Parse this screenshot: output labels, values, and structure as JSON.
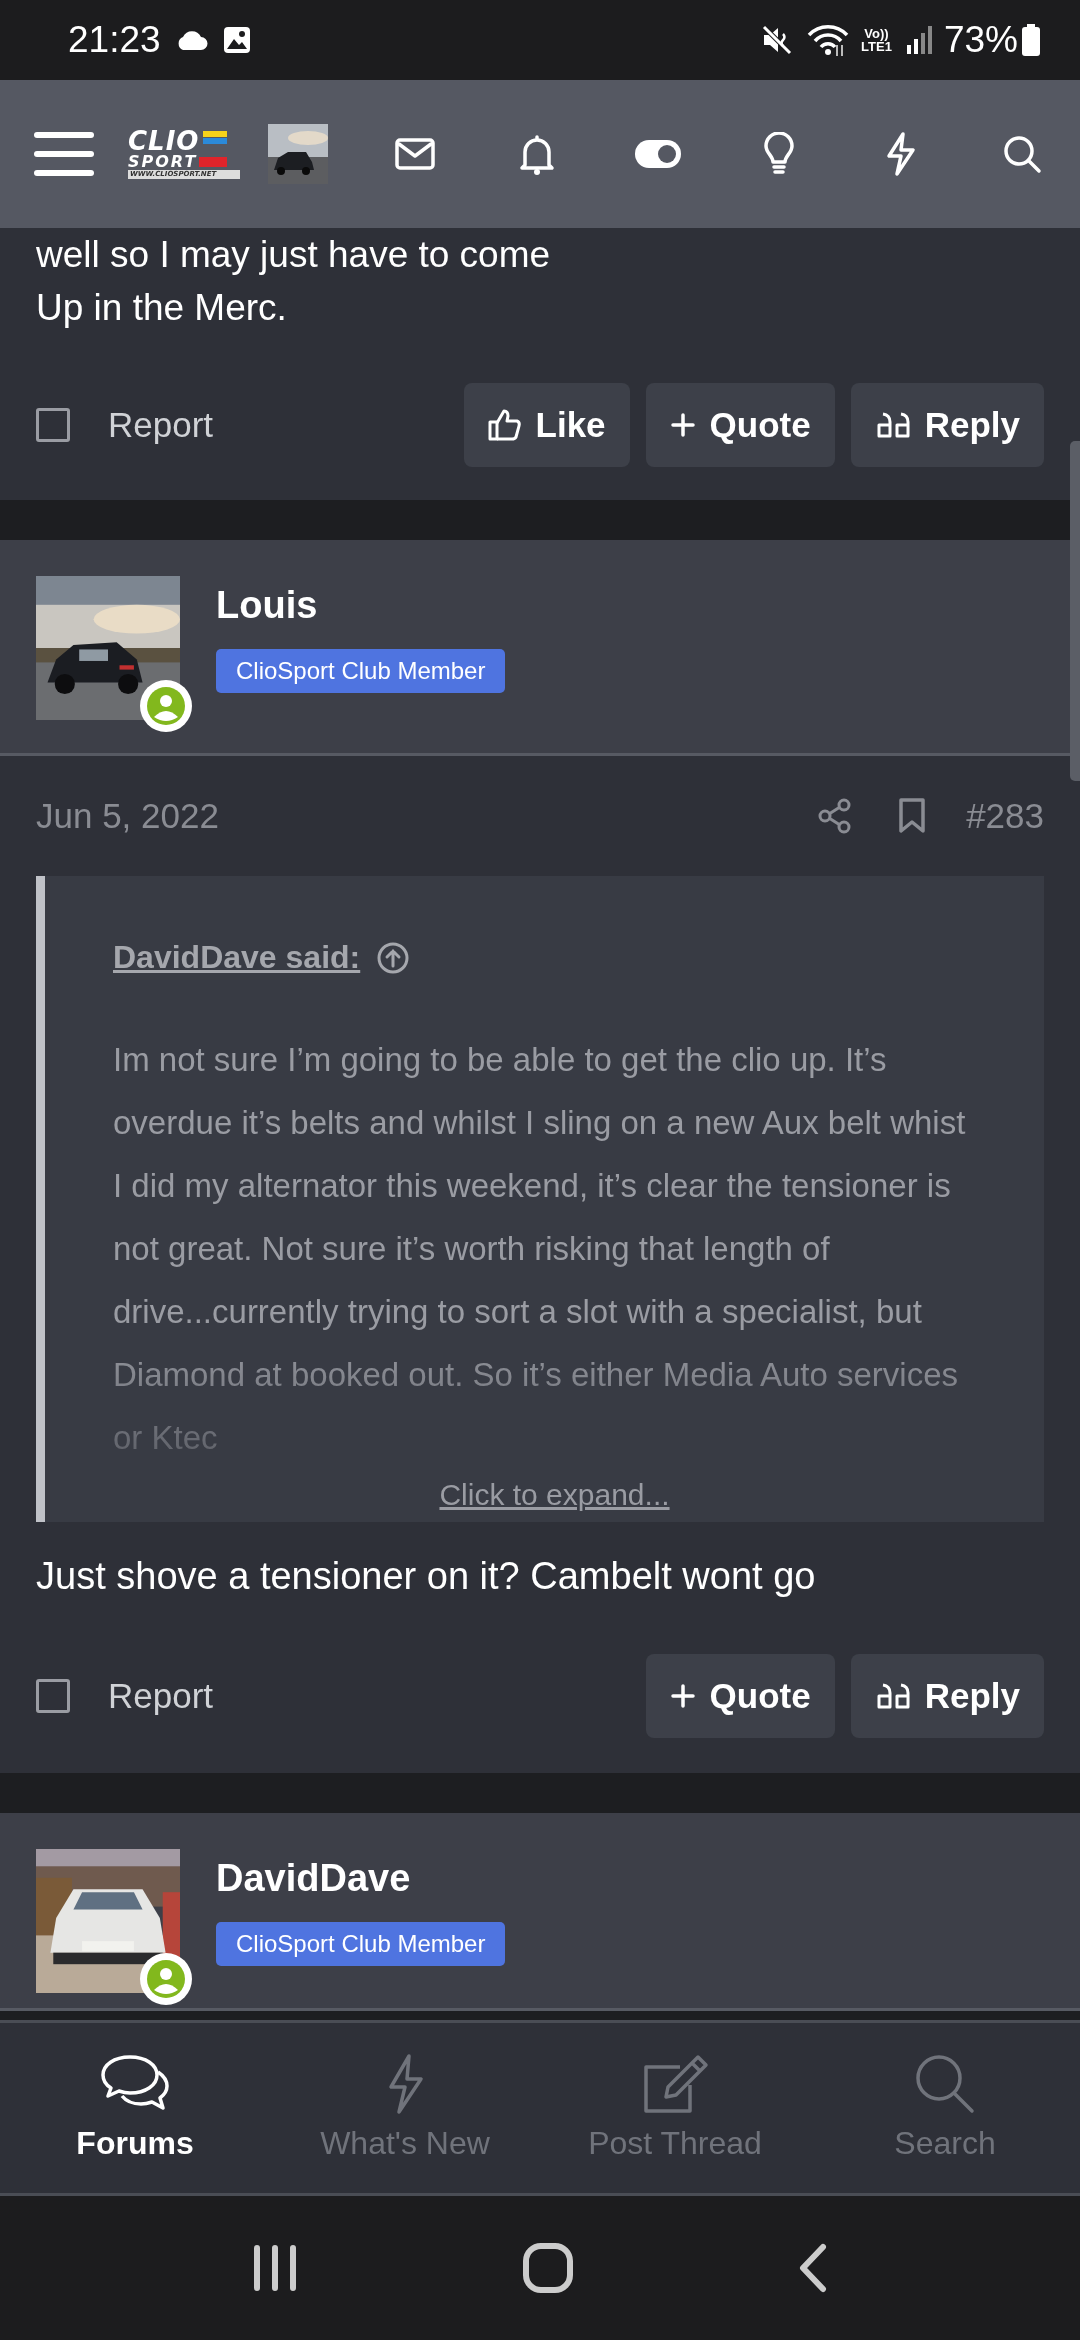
{
  "status_bar": {
    "time": "21:23",
    "network": "Vo))",
    "network_sub": "LTE1",
    "battery": "73%"
  },
  "header": {
    "logo": {
      "line1": "CLIO",
      "line2": "SPORT",
      "url": "WWW.CLIOSPORT.NET"
    }
  },
  "posts": [
    {
      "kind": "tail",
      "body_lines": [
        "well so I may just have to come",
        "Up in the Merc."
      ],
      "actions": {
        "report": {
          "label": "Report",
          "checked": false
        },
        "buttons": [
          {
            "kind": "like",
            "label": "Like"
          },
          {
            "kind": "quote",
            "label": "Quote"
          },
          {
            "kind": "reply",
            "label": "Reply"
          }
        ]
      }
    },
    {
      "kind": "full",
      "author": "Louis",
      "badge": "ClioSport Club Member",
      "date": "Jun 5, 2022",
      "number": "#283",
      "quote": {
        "author": "DavidDave said:",
        "text": "Im not sure I’m going to be able to get the clio up. It’s overdue it’s belts and whilst I sling on a new Aux belt whist I did my alternator this weekend, it’s clear the tensioner is not great. Not sure it’s worth risking that length of drive...currently trying to sort a slot with a specialist, but Diamond at booked out. So it’s either Media Auto services or Ktec",
        "expand": "Click to expand..."
      },
      "body": "Just shove a tensioner on it? Cambelt wont go",
      "actions": {
        "report": {
          "label": "Report",
          "checked": false
        },
        "buttons": [
          {
            "kind": "quote",
            "label": "Quote"
          },
          {
            "kind": "reply",
            "label": "Reply"
          }
        ]
      }
    },
    {
      "kind": "head",
      "author": "DavidDave",
      "badge": "ClioSport Club Member"
    }
  ],
  "bottom_nav": [
    {
      "kind": "forums",
      "label": "Forums",
      "selected": true
    },
    {
      "kind": "whats-new",
      "label": "What's New",
      "selected": false
    },
    {
      "kind": "post-thread",
      "label": "Post Thread",
      "selected": false
    },
    {
      "kind": "search",
      "label": "Search",
      "selected": false
    }
  ]
}
